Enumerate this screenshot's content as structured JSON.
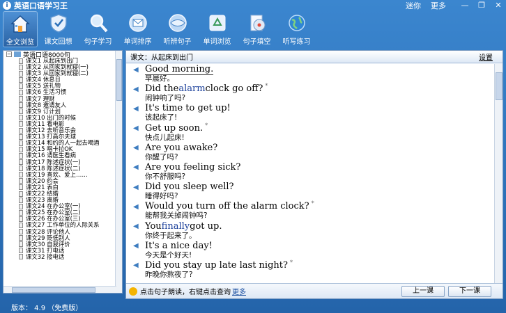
{
  "app": {
    "title": "英语口语学习王",
    "menu_mini": "迷你",
    "menu_more": "更多"
  },
  "toolbar": [
    {
      "label": "全文浏览",
      "icon": "house-icon"
    },
    {
      "label": "课文回想",
      "icon": "shield-check-icon"
    },
    {
      "label": "句子学习",
      "icon": "magnifier-icon"
    },
    {
      "label": "单词排序",
      "icon": "mail-icon"
    },
    {
      "label": "听辨句子",
      "icon": "globe-icon"
    },
    {
      "label": "单词浏览",
      "icon": "recycle-icon"
    },
    {
      "label": "句子填空",
      "icon": "disc-icon"
    },
    {
      "label": "听写练习",
      "icon": "earth-icon"
    }
  ],
  "tree": {
    "root": "英语口语8000句",
    "items": [
      "课文1 从起床到出门",
      "课文2 从回家到就寝(一)",
      "课文3 从回家到就寝(二)",
      "课文4 休息日",
      "课文5 送礼物",
      "课文6 生活习惯",
      "课文7 理财",
      "课文8 邀请友人",
      "课文9 订计划",
      "课文10 出门的时候",
      "课文11 看电影",
      "课文12 去听音乐会",
      "课文13 打高尔夫球",
      "课文14 和约的人一起去喝酒",
      "课文15 唱卡拉OK",
      "课文16 请医生看病",
      "课文17 陈述症状(一)",
      "课文18 陈述症状(二)",
      "课文19 喜欢、爱上……",
      "课文20 约会",
      "课文21 表白",
      "课文22 结婚",
      "课文23 离婚",
      "课文24 在办公室(一)",
      "课文25 在办公室(二)",
      "课文26 在办公室(三)",
      "课文27 工作单位的人际关系",
      "课文28 评论他人",
      "课文29 贬低别人",
      "课文30 自我评价",
      "课文31 打电话",
      "课文32 接电话"
    ]
  },
  "panel": {
    "lesson_title": "课文：从起床到出门",
    "settings": "设置",
    "sentences": [
      {
        "en": "Good morning.",
        "zh": "早晨好。"
      },
      {
        "en_pre": "Did the ",
        "en_hl": "alarm",
        "en_post": " clock go off?",
        "star": "*",
        "zh": "闹钟响了吗?"
      },
      {
        "en": "It's time to get up!",
        "zh": "该起床了!"
      },
      {
        "en": "Get up soon.",
        "star": "*",
        "zh": "快点儿起床!"
      },
      {
        "en": "Are you awake?",
        "zh": "你醒了吗?"
      },
      {
        "en": "Are you feeling sick?",
        "zh": "你不舒服吗?"
      },
      {
        "en": "Did you sleep well?",
        "zh": "睡得好吗?"
      },
      {
        "en": "Would you turn off the alarm clock?",
        "star": "*",
        "zh": "能帮我关掉闹钟吗?"
      },
      {
        "en_pre": "You ",
        "en_hl": "finally",
        "en_post": " got up.",
        "zh": "你终于起来了。"
      },
      {
        "en": "It's a nice day!",
        "zh": "今天是个好天!"
      },
      {
        "en": "Did you stay up late last night?",
        "star": "*",
        "zh": "昨晚你熬夜了?"
      }
    ],
    "footer_tip": "点击句子朗读，右键点击查询",
    "footer_more": "更多",
    "prev_button": "上一课",
    "next_button": "下一课"
  },
  "status": {
    "version": "版本： 4.9  （免费版）"
  }
}
